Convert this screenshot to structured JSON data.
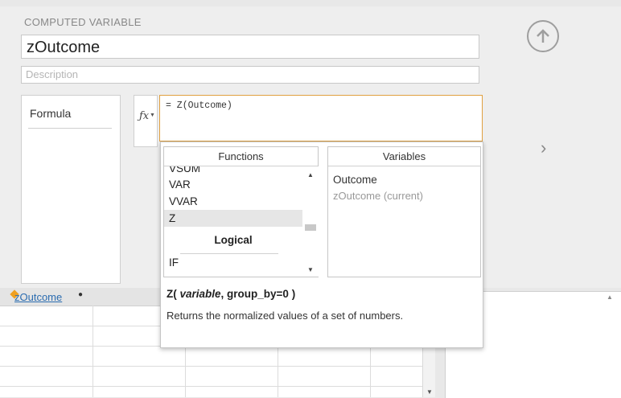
{
  "computed": {
    "section_title": "COMPUTED VARIABLE",
    "name": "zOutcome",
    "description_placeholder": "Description",
    "formula_tab": "Formula",
    "formula": "= Z(Outcome)"
  },
  "functions": {
    "header": "Functions",
    "items_before": [
      "VSUM",
      "VAR",
      "VVAR",
      "Z"
    ],
    "selected": "Z",
    "group_label": "Logical",
    "items_after": [
      "IF"
    ]
  },
  "variables": {
    "header": "Variables",
    "items": [
      "Outcome",
      "zOutcome (current)"
    ]
  },
  "help": {
    "sig_name": "Z(",
    "sig_args": " variable",
    "sig_rest": ", group_by=0 )",
    "description": "Returns the normalized values of a set of numbers."
  },
  "sheet": {
    "column_name": "zOutcome"
  },
  "icons": {
    "up": "arrow-up-circle-icon",
    "next": "chevron-right-icon",
    "fx": "function-icon"
  },
  "colors": {
    "accent": "#e0a040",
    "link": "#2b6cb0",
    "selected_bg": "#e6e6e6"
  }
}
